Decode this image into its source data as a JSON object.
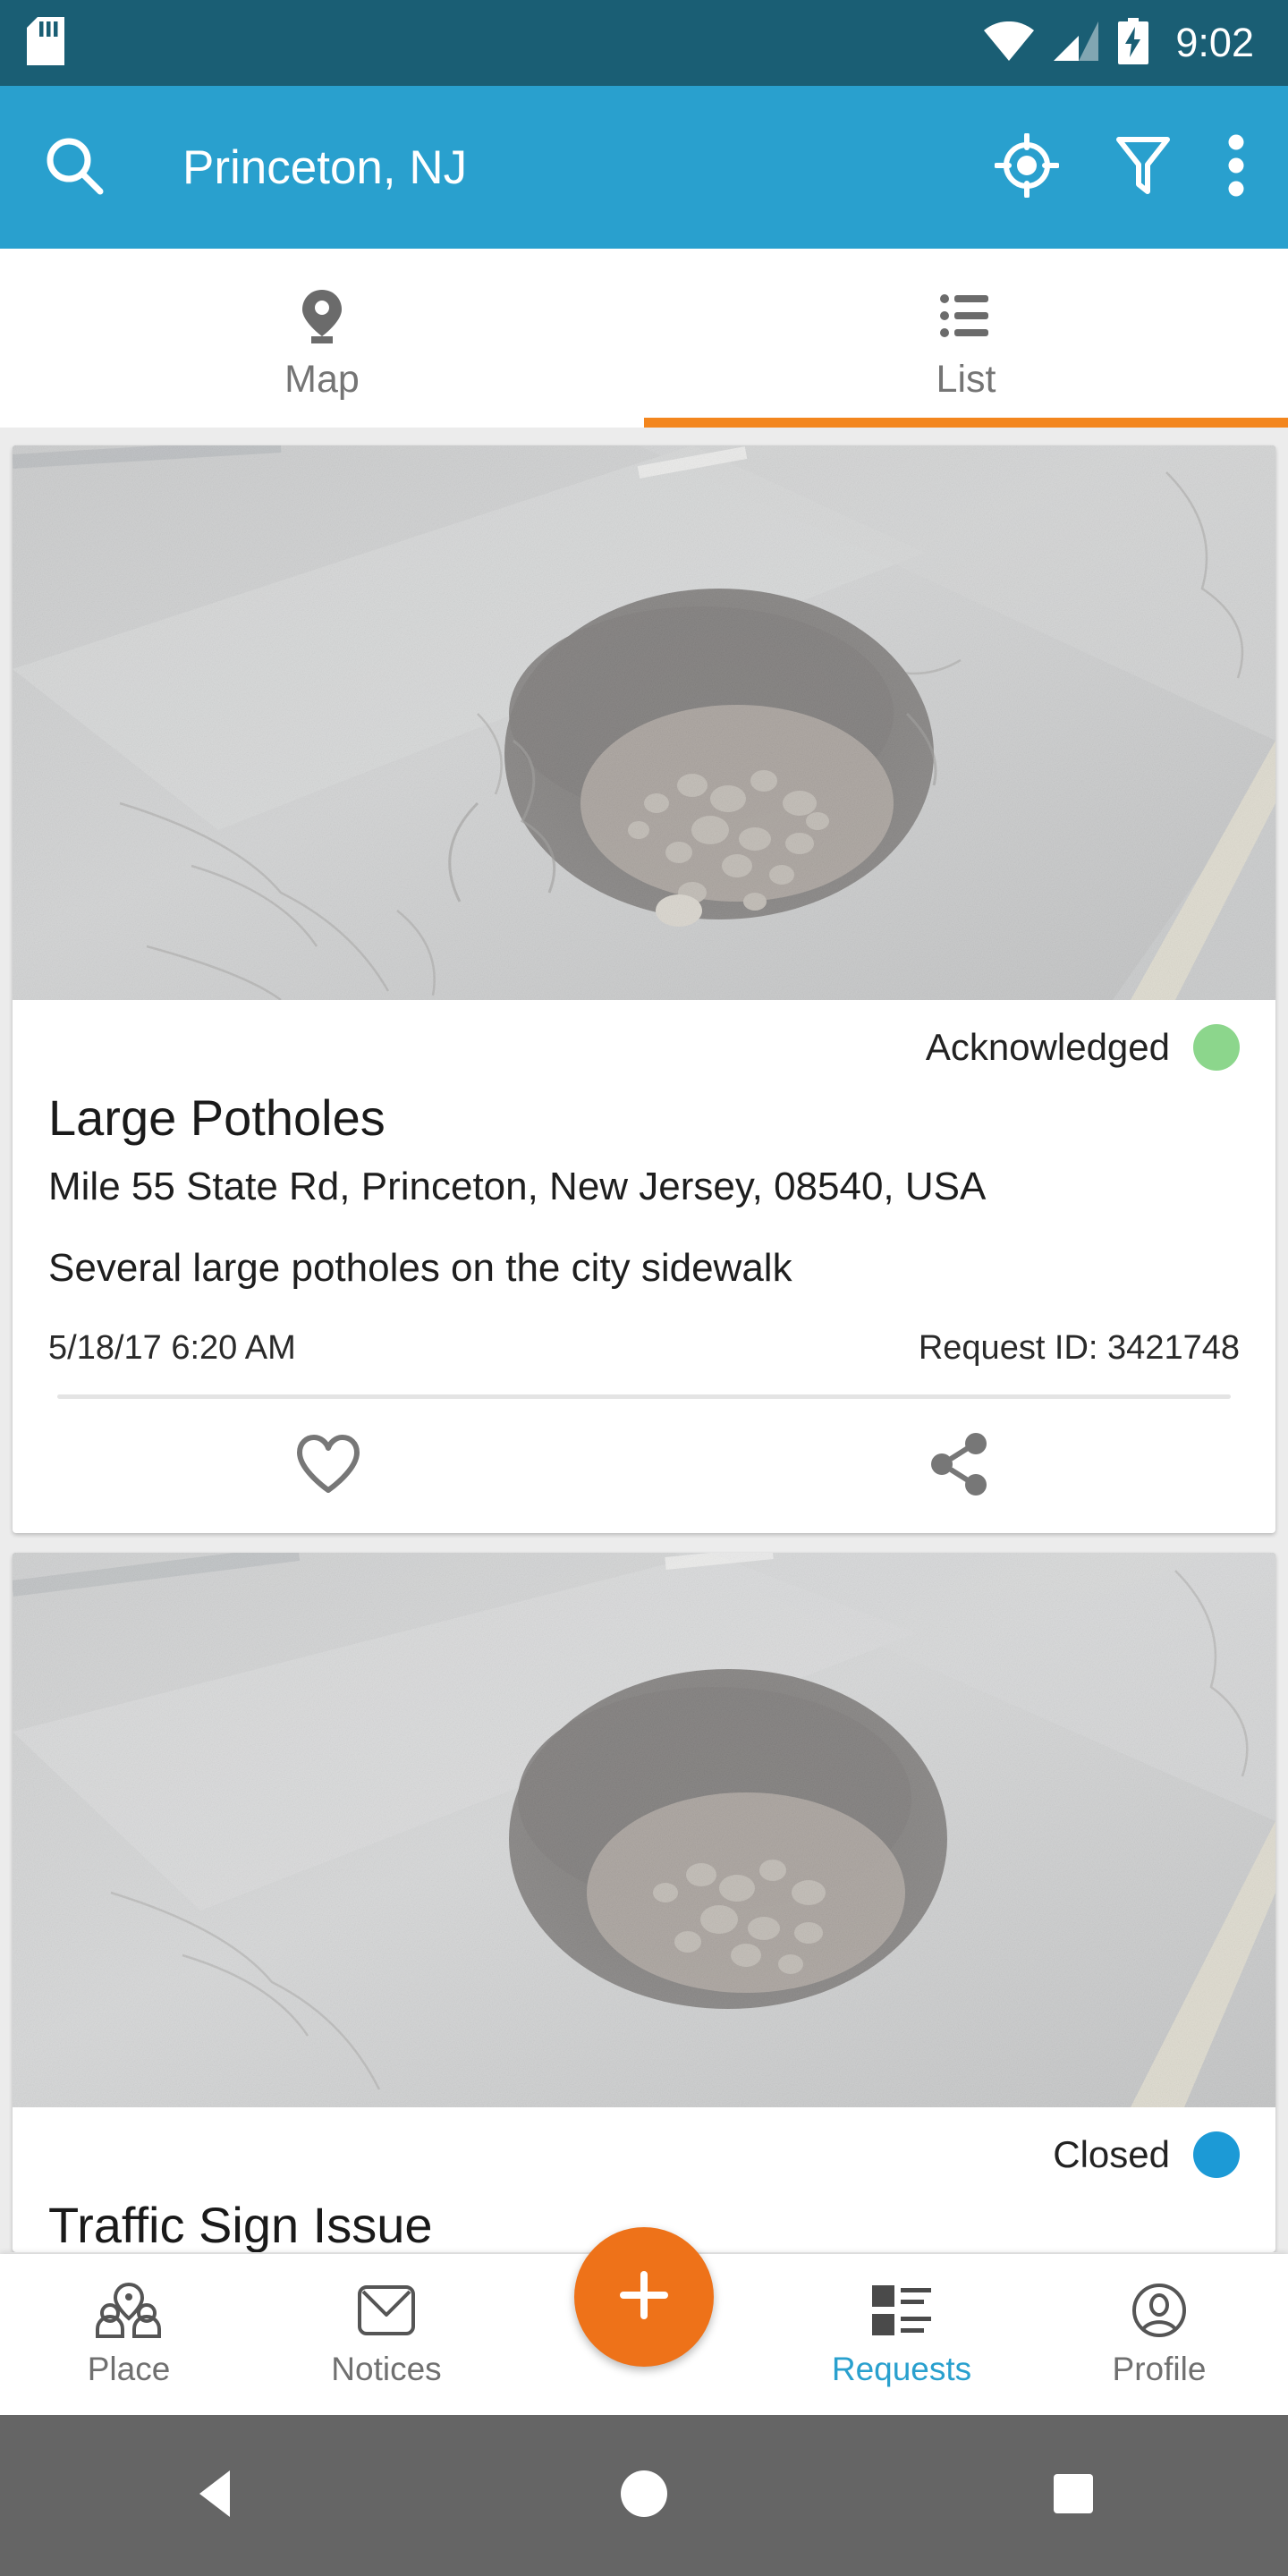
{
  "status_bar": {
    "time": "9:02",
    "icons": [
      "sd-card-icon",
      "wifi-icon",
      "cell-signal-icon",
      "battery-charging-icon"
    ]
  },
  "app_bar": {
    "title": "Princeton, NJ",
    "search_icon": "search-icon",
    "my_location_icon": "my-location-icon",
    "filter_icon": "filter-icon",
    "overflow_icon": "overflow-menu-icon",
    "background_color": "#29A0CE"
  },
  "tabs": {
    "active_index": 1,
    "indicator_color": "#F3861E",
    "items": [
      {
        "label": "Map",
        "icon": "map-pin-icon"
      },
      {
        "label": "List",
        "icon": "list-icon"
      }
    ]
  },
  "requests": [
    {
      "status_label": "Acknowledged",
      "status_color": "#8CD68C",
      "title": "Large Potholes",
      "address": "Mile 55 State Rd, Princeton, New Jersey, 08540, USA",
      "description": "Several large potholes on the city sidewalk",
      "timestamp": "5/18/17 6:20 AM",
      "request_id": "Request ID: 3421748",
      "photo_alt": "pothole-photo",
      "actions": [
        {
          "name": "favorite-button",
          "icon": "heart-icon"
        },
        {
          "name": "share-button",
          "icon": "share-icon"
        }
      ]
    },
    {
      "status_label": "Closed",
      "status_color": "#1C9AD6",
      "title": "Traffic Sign Issue",
      "photo_alt": "pothole-photo"
    }
  ],
  "bottom_nav": {
    "active": "Requests",
    "active_color": "#29A0CE",
    "fab": {
      "icon": "plus-icon",
      "color": "#EE7219"
    },
    "items": [
      {
        "label": "Place",
        "icon": "place-people-icon"
      },
      {
        "label": "Notices",
        "icon": "envelope-icon"
      },
      {
        "label": "Requests",
        "icon": "requests-list-icon"
      },
      {
        "label": "Profile",
        "icon": "account-circle-icon"
      }
    ]
  },
  "system_nav": {
    "back": "back-triangle-icon",
    "home": "home-circle-icon",
    "recents": "recents-square-icon"
  }
}
